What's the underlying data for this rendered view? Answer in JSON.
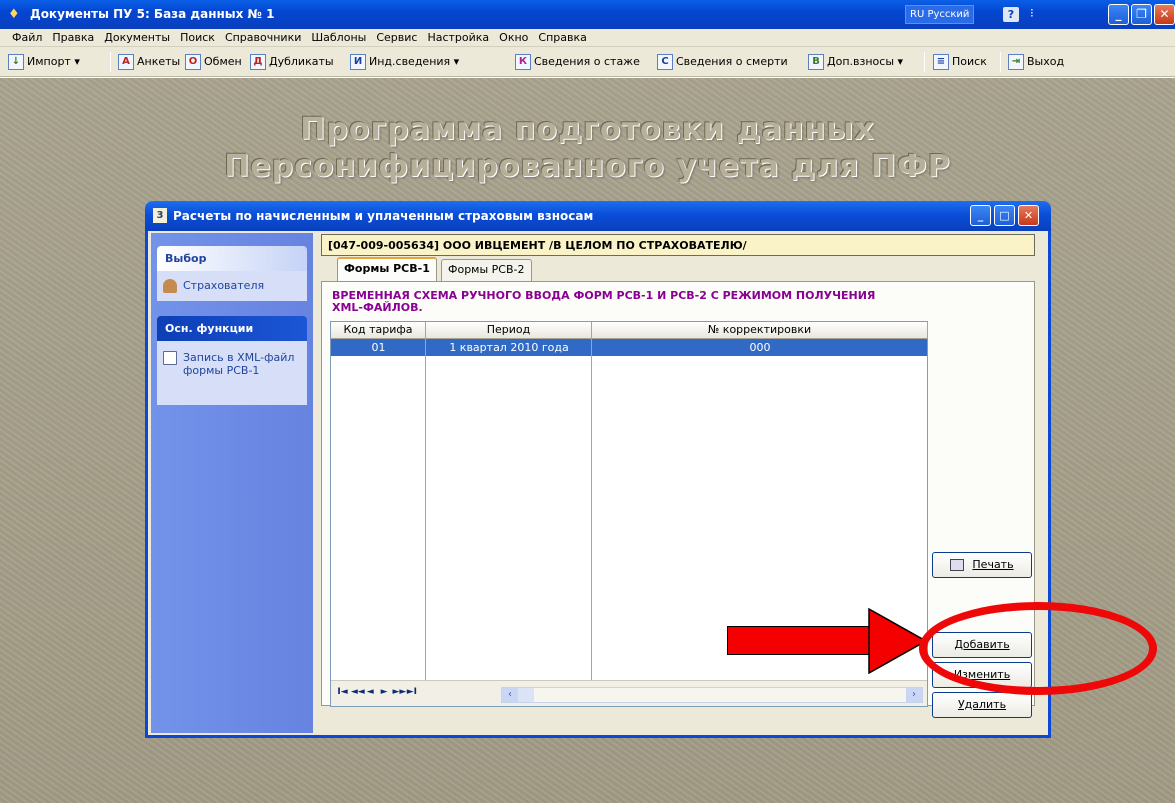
{
  "window": {
    "title": "Документы ПУ 5: База данных № 1",
    "language": "RU Русский",
    "help_glyph": "?",
    "lang_menu_glyph": "⁝"
  },
  "menu": [
    "Файл",
    "Правка",
    "Документы",
    "Поиск",
    "Справочники",
    "Шаблоны",
    "Сервис",
    "Настройка",
    "Окно",
    "Справка"
  ],
  "toolbar": {
    "import": "Импорт",
    "ankety": "Анкеты",
    "obmen": "Обмен",
    "dublikaty": "Дубликаты",
    "ind_svedenia": "Инд.сведения",
    "stazh": "Сведения о стаже",
    "smert": "Сведения о смерти",
    "dop_vznosy": "Доп.взносы",
    "poisk": "Поиск",
    "vyhod": "Выход"
  },
  "banner": {
    "line1": "Программа подготовки данных",
    "line2": "Персонифицированного учета для ПФР"
  },
  "dialog": {
    "title": "Расчеты по начисленным и уплаченным страховым взносам",
    "icon_glyph": "3"
  },
  "leftpanel": {
    "section1": "Выбор",
    "item1": "Страхователя",
    "section2": "Осн. функции",
    "item2": "Запись в XML-файл формы РСВ-1"
  },
  "org_bar": "[047-009-005634] ООО ИВЦЕМЕНТ /В ЦЕЛОМ ПО СТРАХОВАТЕЛЮ/",
  "tabs": [
    "Формы РСВ-1",
    "Формы РСВ-2"
  ],
  "caption": "ВРЕМЕННАЯ СХЕМА РУЧНОГО ВВОДА ФОРМ РСВ-1 И РСВ-2 С РЕЖИМОМ ПОЛУЧЕНИЯ XML-ФАЙЛОВ.",
  "grid": {
    "columns": [
      "Код тарифа",
      "Период",
      "№ корректировки"
    ],
    "rows": [
      [
        "01",
        "1 квартал 2010 года",
        "000"
      ]
    ]
  },
  "nav_glyphs": [
    "I◄",
    "◄◄",
    "◄",
    "►",
    "►►",
    "►I"
  ],
  "buttons": {
    "print": "Печать",
    "add": "Добавить",
    "edit": "Изменить",
    "delete": "Удалить"
  }
}
